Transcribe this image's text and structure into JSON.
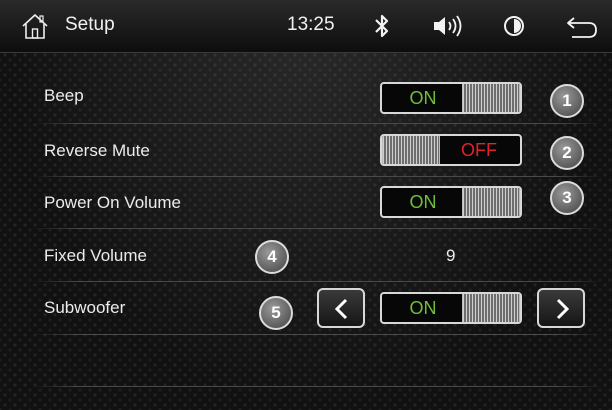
{
  "header": {
    "title": "Setup",
    "time": "13:25",
    "icons": [
      "home-icon",
      "bluetooth-icon",
      "volume-icon",
      "brightness-icon",
      "back-icon"
    ]
  },
  "settings": [
    {
      "label": "Beep",
      "type": "toggle",
      "value": "ON",
      "badge": "1"
    },
    {
      "label": "Reverse Mute",
      "type": "toggle",
      "value": "OFF",
      "badge": "2"
    },
    {
      "label": "Power On Volume",
      "type": "toggle",
      "value": "ON",
      "badge": "3"
    },
    {
      "label": "Fixed Volume",
      "type": "value",
      "value": "9",
      "badge": "4"
    },
    {
      "label": "Subwoofer",
      "type": "toggle-with-arrows",
      "value": "ON",
      "badge": "5"
    }
  ],
  "colors": {
    "on_text": "#6fbf3c",
    "off_text": "#e0222a",
    "label_text": "#ececec"
  }
}
